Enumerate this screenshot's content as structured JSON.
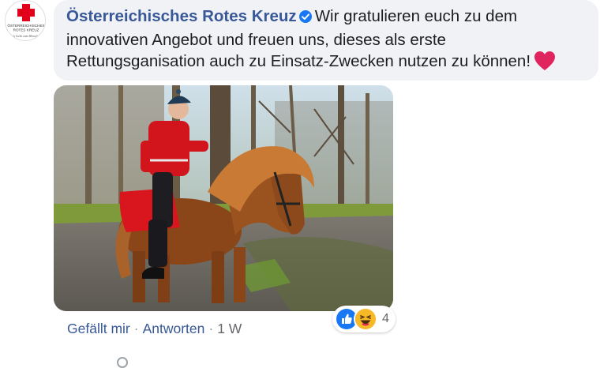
{
  "comment": {
    "author": "Österreichisches Rotes Kreuz",
    "avatar": {
      "org_line_1": "ÖSTERREICHISCHES",
      "org_line_2": "ROTES KREUZ",
      "slogan": "Aus Liebe zum Menschen."
    },
    "text": "Wir gratulieren euch zu dem innovativen Angebot und freuen uns, dieses als erste Rettungsganisation auch zu Einsatz-Zwecken nutzen zu können!",
    "emoji": "heart",
    "verified": true
  },
  "photo": {
    "subject": "horse-rider"
  },
  "actions": {
    "like_label": "Gefällt mir",
    "reply_label": "Antworten",
    "separator": "·",
    "time": "1 W"
  },
  "reactions": {
    "icons": [
      "like",
      "haha"
    ],
    "count": "4"
  },
  "colors": {
    "author": "#385898",
    "bubble": "#f0f2f5",
    "like_blue": "#1877f2",
    "haha_yellow": "#f7b928",
    "red_cross": "#e2001a",
    "heart": "#e0245e"
  }
}
